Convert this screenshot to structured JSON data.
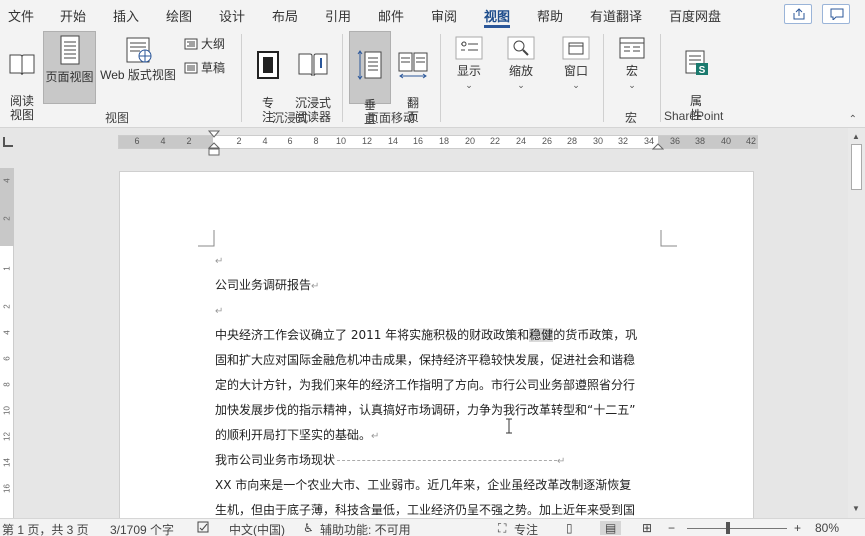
{
  "menu": {
    "items": [
      "文件",
      "开始",
      "插入",
      "绘图",
      "设计",
      "布局",
      "引用",
      "邮件",
      "审阅",
      "视图",
      "帮助",
      "有道翻译",
      "百度网盘"
    ],
    "active": "视图"
  },
  "ribbon": {
    "views": {
      "read_mode": "阅读\n视图",
      "print_layout": "页面视图",
      "web_layout": "Web 版式视图",
      "outline": "大纲",
      "draft": "草稿",
      "label": "视图"
    },
    "immersive": {
      "focus": "专\n注",
      "immersive_reader": "沉浸式\n阅读器",
      "label": "沉浸式"
    },
    "page_movement": {
      "vertical": "垂\n直",
      "side_to_side": "翻\n页",
      "label": "页面移动"
    },
    "show": "显示",
    "zoom": "缩放",
    "window": "窗口",
    "macros": {
      "button": "宏",
      "label": "宏"
    },
    "sharepoint": {
      "button": "属\n性",
      "label": "SharePoint"
    }
  },
  "ruler": {
    "ticks": [
      "6",
      "4",
      "2",
      "2",
      "4",
      "6",
      "8",
      "10",
      "12",
      "14",
      "16",
      "18",
      "20",
      "22",
      "24",
      "26",
      "28",
      "30",
      "32",
      "34",
      "36",
      "38",
      "40",
      "42"
    ],
    "vticks": [
      "4",
      "2",
      "1",
      "2",
      "4",
      "6",
      "8",
      "10",
      "12",
      "14",
      "16"
    ]
  },
  "document": {
    "title": "公司业务调研报告",
    "p1_line1_a": "中央经济工作会议确立了 2011 年将实施积极的财政政策和",
    "p1_line1_hl": "稳健",
    "p1_line1_b": "的货币政策，巩",
    "p1_line2": "固和扩大应对国际金融危机冲击成果，保持经济平稳较快发展，促进社会和谐稳",
    "p1_line3": "定的大计方针，为我们来年的经济工作指明了方向。市行公司业务部遵照省分行",
    "p1_line4": "加快发展步伐的指示精神，认真搞好市场调研，力争为我行改革转型和“十二五”",
    "p1_line5": "的顺利开局打下坚实的基础。",
    "heading2": "我市公司业务市场现状",
    "p2_line1": "XX 市向来是一个农业大市、工业弱市。近几年来，企业虽经改革改制逐渐恢复",
    "p2_line2": "生机，但由于底子薄，科技含量低，工业经济仍呈不强之势。加上近年来受到国"
  },
  "status": {
    "page": "第 1 页，共 3 页",
    "words": "3/1709 个字",
    "language": "中文(中国)",
    "accessibility": "辅助功能: 不可用",
    "focus": "专注",
    "zoom": "80%"
  }
}
